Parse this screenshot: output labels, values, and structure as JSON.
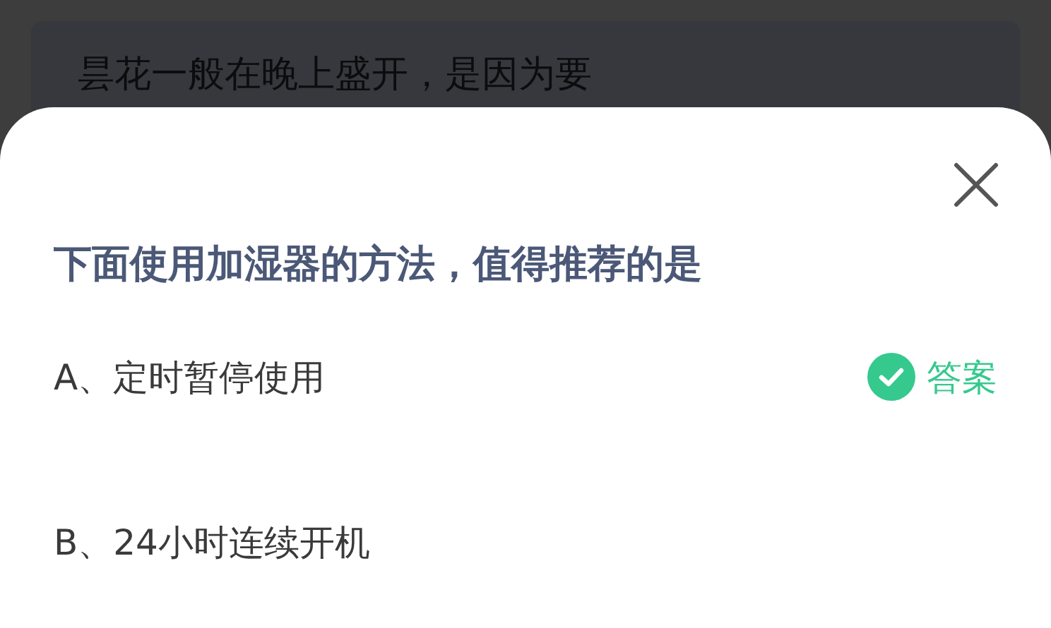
{
  "background_question": "昙花一般在晚上盛开，是因为要",
  "question": "下面使用加湿器的方法，值得推荐的是",
  "answer_label": "答案",
  "options": [
    {
      "text": "A、定时暂停使用",
      "correct": true
    },
    {
      "text": "B、24小时连续开机",
      "correct": false
    }
  ]
}
